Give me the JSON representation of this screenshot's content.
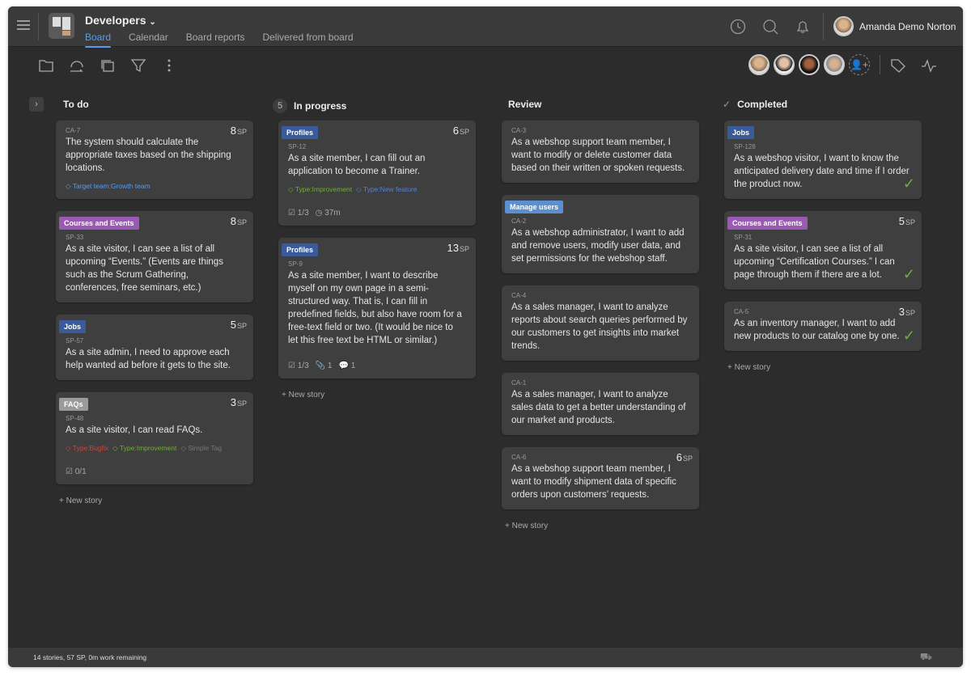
{
  "header": {
    "title": "Developers",
    "tabs": [
      "Board",
      "Calendar",
      "Board reports",
      "Delivered from board"
    ],
    "user": "Amanda Demo Norton"
  },
  "columns": [
    {
      "title": "To do",
      "count": null,
      "cards": [
        {
          "key": "CA-7",
          "sp": "8",
          "text": "The system should calculate the appropriate taxes based on the shipping locations.",
          "labels": [
            {
              "t": "Target team:Growth team",
              "c": "#5b9bea"
            }
          ]
        },
        {
          "tag": "Courses and Events",
          "tagColor": "#9b59b6",
          "key": "SP-33",
          "sp": "8",
          "text": "As a site visitor, I can see a list of all upcoming “Events.” (Events are things such as the Scrum Gathering, conferences, free seminars, etc.)"
        },
        {
          "tag": "Jobs",
          "tagColor": "#3a5b9b",
          "key": "SP-57",
          "sp": "5",
          "text": "As a site admin, I need to approve each help wanted ad before it gets to the site."
        },
        {
          "tag": "FAQs",
          "tagColor": "#9a9a9a",
          "key": "SP-48",
          "sp": "3",
          "text": "As a site visitor, I can read FAQs.",
          "labels": [
            {
              "t": "Type:Bugfix",
              "c": "#d0433a"
            },
            {
              "t": "Type:Improvement",
              "c": "#6fae3a"
            },
            {
              "t": "Simple Tag",
              "c": "#777"
            }
          ],
          "meta": [
            "0/1"
          ]
        }
      ]
    },
    {
      "title": "In progress",
      "count": "5",
      "cards": [
        {
          "tag": "Profiles",
          "tagColor": "#3a5b9b",
          "key": "SP-12",
          "sp": "6",
          "text": "As a site member, I can fill out an application to become a Trainer.",
          "labels": [
            {
              "t": "Type:Improvement",
              "c": "#6fae3a"
            },
            {
              "t": "Type:New feature",
              "c": "#5b7fd0"
            }
          ],
          "meta": [
            "1/3",
            "37m"
          ]
        },
        {
          "tag": "Profiles",
          "tagColor": "#3a5b9b",
          "key": "SP-9",
          "sp": "13",
          "text": "As a site member, I want to describe myself on my own page in a semi-structured way. That is, I can fill in predefined fields, but also have room for a free-text field or two. (It would be nice to let this free text be HTML or similar.)",
          "meta": [
            "1/3",
            "1",
            "1"
          ]
        }
      ]
    },
    {
      "title": "Review",
      "count": null,
      "cards": [
        {
          "key": "CA-3",
          "text": "As a webshop support team member, I want to modify or delete customer data based on their written or spoken requests."
        },
        {
          "tag": "Manage users",
          "tagColor": "#5b8fd0",
          "key": "CA-2",
          "text": "As a webshop administrator, I want to add and remove users, modify user data, and set permissions for the webshop staff."
        },
        {
          "key": "CA-4",
          "text": "As a sales manager, I want to analyze reports about search queries performed by our customers to get insights into market trends."
        },
        {
          "key": "CA-1",
          "text": "As a sales manager, I want to analyze sales data to get a better understanding of our market and products."
        },
        {
          "key": "CA-6",
          "sp": "6",
          "text": "As a webshop support team member, I want to modify shipment data of specific orders upon customers’ requests."
        }
      ]
    },
    {
      "title": "Completed",
      "count": null,
      "cards": [
        {
          "tag": "Jobs",
          "tagColor": "#3a5b9b",
          "key": "SP-128",
          "text": "As a webshop visitor, I want to know the anticipated delivery date and time if I order the product now.",
          "done": true
        },
        {
          "tag": "Courses and Events",
          "tagColor": "#9b59b6",
          "key": "SP-31",
          "sp": "5",
          "text": "As a site visitor, I can see a list of all upcoming “Certification Courses.” I can page through them if there are a lot.",
          "done": true
        },
        {
          "key": "CA-5",
          "sp": "3",
          "text": "As an inventory manager, I want to add new products to our catalog one by one.",
          "done": true
        }
      ]
    }
  ],
  "sp_unit": "SP",
  "new_story": "+ New story",
  "footer": "14 stories, 57 SP, 0m work remaining"
}
